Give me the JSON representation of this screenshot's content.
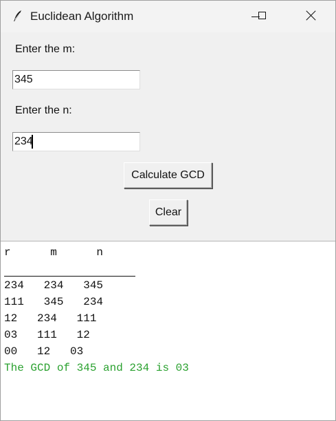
{
  "window": {
    "title": "Euclidean Algorithm"
  },
  "icons": {
    "app": "feather-icon",
    "minimize": "minimize-icon",
    "maximize": "maximize-icon",
    "close": "close-icon"
  },
  "form": {
    "m_label": "Enter the m:",
    "m_value": "345",
    "n_label": "Enter the n:",
    "n_value": "234"
  },
  "buttons": {
    "calculate": "Calculate GCD",
    "clear": "Clear"
  },
  "output": {
    "header": "r      m      n",
    "rows": [
      "234   234   345",
      "111   345   234",
      "12   234   111",
      "03   111   12",
      "00   12   03"
    ],
    "result": "The GCD of 345 and 234 is 03",
    "result_color": "#2aa12f"
  }
}
